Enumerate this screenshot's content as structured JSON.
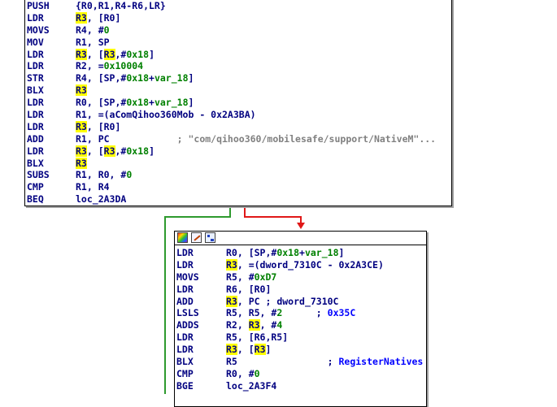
{
  "colors": {
    "register_text": "#000080",
    "immediate": "#008000",
    "highlight_bg": "#ffff00",
    "string_comment": "#808080",
    "comment": "#0000ff",
    "edge_true": "#2e9a2e",
    "edge_false": "#e01818",
    "block_shadow": "#a0a0a0"
  },
  "block1": {
    "lines": [
      {
        "mnemonic": "PUSH",
        "operands": [
          {
            "t": "{R0,R1,R4-R6,LR}",
            "c": "plain"
          }
        ]
      },
      {
        "mnemonic": "LDR",
        "operands": [
          {
            "t": "R3",
            "c": "hl"
          },
          {
            "t": ", [R0]",
            "c": "plain"
          }
        ]
      },
      {
        "mnemonic": "MOVS",
        "operands": [
          {
            "t": "R4, #",
            "c": "plain"
          },
          {
            "t": "0",
            "c": "num"
          }
        ]
      },
      {
        "mnemonic": "MOV",
        "operands": [
          {
            "t": "R1, SP",
            "c": "plain"
          }
        ]
      },
      {
        "mnemonic": "LDR",
        "operands": [
          {
            "t": "R3",
            "c": "hl"
          },
          {
            "t": ", [",
            "c": "plain"
          },
          {
            "t": "R3",
            "c": "hl"
          },
          {
            "t": ",#",
            "c": "plain"
          },
          {
            "t": "0x18",
            "c": "num"
          },
          {
            "t": "]",
            "c": "plain"
          }
        ]
      },
      {
        "mnemonic": "LDR",
        "operands": [
          {
            "t": "R2, =",
            "c": "plain"
          },
          {
            "t": "0x10004",
            "c": "num"
          }
        ]
      },
      {
        "mnemonic": "STR",
        "operands": [
          {
            "t": "R4, [SP,#",
            "c": "plain"
          },
          {
            "t": "0x18",
            "c": "num"
          },
          {
            "t": "+",
            "c": "plain"
          },
          {
            "t": "var_18",
            "c": "var"
          },
          {
            "t": "]",
            "c": "plain"
          }
        ]
      },
      {
        "mnemonic": "BLX",
        "operands": [
          {
            "t": "R3",
            "c": "hl"
          }
        ]
      },
      {
        "mnemonic": "LDR",
        "operands": [
          {
            "t": "R0, [SP,#",
            "c": "plain"
          },
          {
            "t": "0x18",
            "c": "num"
          },
          {
            "t": "+",
            "c": "plain"
          },
          {
            "t": "var_18",
            "c": "var"
          },
          {
            "t": "]",
            "c": "plain"
          }
        ]
      },
      {
        "mnemonic": "LDR",
        "operands": [
          {
            "t": "R1, =(aComQihoo360Mob - 0x2A3BA)",
            "c": "plain"
          }
        ]
      },
      {
        "mnemonic": "LDR",
        "operands": [
          {
            "t": "R3",
            "c": "hl"
          },
          {
            "t": ", [R0]",
            "c": "plain"
          }
        ]
      },
      {
        "mnemonic": "ADD",
        "operands": [
          {
            "t": "R1, PC            ",
            "c": "plain"
          },
          {
            "t": "; \"com/qihoo360/mobilesafe/support/NativeM\"...",
            "c": "str"
          }
        ]
      },
      {
        "mnemonic": "LDR",
        "operands": [
          {
            "t": "R3",
            "c": "hl"
          },
          {
            "t": ", [",
            "c": "plain"
          },
          {
            "t": "R3",
            "c": "hl"
          },
          {
            "t": ",#",
            "c": "plain"
          },
          {
            "t": "0x18",
            "c": "num"
          },
          {
            "t": "]",
            "c": "plain"
          }
        ]
      },
      {
        "mnemonic": "BLX",
        "operands": [
          {
            "t": "R3",
            "c": "hl"
          }
        ]
      },
      {
        "mnemonic": "SUBS",
        "operands": [
          {
            "t": "R1, R0, #",
            "c": "plain"
          },
          {
            "t": "0",
            "c": "num"
          }
        ]
      },
      {
        "mnemonic": "CMP",
        "operands": [
          {
            "t": "R1, R4",
            "c": "plain"
          }
        ]
      },
      {
        "mnemonic": "BEQ",
        "operands": [
          {
            "t": "loc_2A3DA",
            "c": "plain"
          }
        ]
      }
    ]
  },
  "block2": {
    "toolbar_icons": [
      "color-palette-icon",
      "edit-pencil-icon",
      "graph-layout-icon"
    ],
    "lines": [
      {
        "mnemonic": "LDR",
        "operands": [
          {
            "t": "R0, [SP,#",
            "c": "plain"
          },
          {
            "t": "0x18",
            "c": "num"
          },
          {
            "t": "+",
            "c": "plain"
          },
          {
            "t": "var_18",
            "c": "var"
          },
          {
            "t": "]",
            "c": "plain"
          }
        ]
      },
      {
        "mnemonic": "LDR",
        "operands": [
          {
            "t": "R3",
            "c": "hl"
          },
          {
            "t": ", =(dword_7310C - 0x2A3CE)",
            "c": "plain"
          }
        ]
      },
      {
        "mnemonic": "MOVS",
        "operands": [
          {
            "t": "R5, #",
            "c": "plain"
          },
          {
            "t": "0xD7",
            "c": "num"
          }
        ]
      },
      {
        "mnemonic": "LDR",
        "operands": [
          {
            "t": "R6, [R0]",
            "c": "plain"
          }
        ]
      },
      {
        "mnemonic": "ADD",
        "operands": [
          {
            "t": "R3",
            "c": "hl"
          },
          {
            "t": ", PC ; dword_7310C",
            "c": "plain"
          }
        ]
      },
      {
        "mnemonic": "LSLS",
        "operands": [
          {
            "t": "R5, R5, #",
            "c": "plain"
          },
          {
            "t": "2",
            "c": "num"
          },
          {
            "t": "      ; ",
            "c": "plain"
          },
          {
            "t": "0x35C",
            "c": "cmt"
          }
        ]
      },
      {
        "mnemonic": "ADDS",
        "operands": [
          {
            "t": "R2, ",
            "c": "plain"
          },
          {
            "t": "R3",
            "c": "hl"
          },
          {
            "t": ", #",
            "c": "plain"
          },
          {
            "t": "4",
            "c": "num"
          }
        ]
      },
      {
        "mnemonic": "LDR",
        "operands": [
          {
            "t": "R5, [R6,R5]",
            "c": "plain"
          }
        ]
      },
      {
        "mnemonic": "LDR",
        "operands": [
          {
            "t": "R3",
            "c": "hl"
          },
          {
            "t": ", [",
            "c": "plain"
          },
          {
            "t": "R3",
            "c": "hl"
          },
          {
            "t": "]",
            "c": "plain"
          }
        ]
      },
      {
        "mnemonic": "BLX",
        "operands": [
          {
            "t": "R5                ; ",
            "c": "plain"
          },
          {
            "t": "RegisterNatives",
            "c": "cmt"
          }
        ]
      },
      {
        "mnemonic": "CMP",
        "operands": [
          {
            "t": "R0, #",
            "c": "plain"
          },
          {
            "t": "0",
            "c": "num"
          }
        ]
      },
      {
        "mnemonic": "BGE",
        "operands": [
          {
            "t": "loc_2A3F4",
            "c": "plain"
          }
        ]
      }
    ]
  }
}
